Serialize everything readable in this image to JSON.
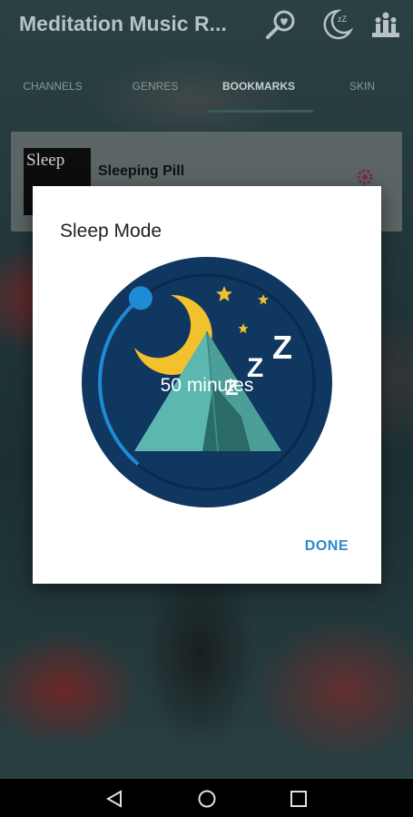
{
  "app": {
    "title": "Meditation Music R..."
  },
  "toolbar": {
    "icons": [
      "search-heart-icon",
      "sleep-moon-icon",
      "temple-icon"
    ]
  },
  "tabs": [
    {
      "label": "CHANNELS"
    },
    {
      "label": "GENRES"
    },
    {
      "label": "BOOKMARKS"
    },
    {
      "label": "SKIN"
    }
  ],
  "bookmark": {
    "thumbnail_text": "Sleep",
    "title": "Sleeping Pill"
  },
  "dialog": {
    "title": "Sleep Mode",
    "timer_value": "50 minutes",
    "timer_fraction": 0.83,
    "done_label": "DONE"
  },
  "colors": {
    "accent": "#2a8bc8",
    "dial_bg": "#0f3760",
    "tent": "#5cb7b0",
    "moon": "#f2c12e"
  },
  "navbar": {
    "icons": [
      "back-icon",
      "home-icon",
      "recents-icon"
    ]
  }
}
